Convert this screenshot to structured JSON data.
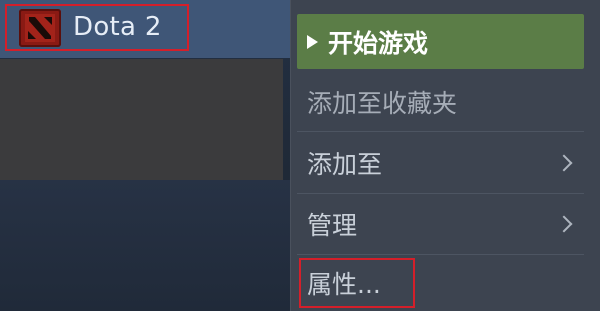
{
  "library": {
    "game": {
      "title": "Dota 2",
      "icon": "dota-logo-icon"
    }
  },
  "context_menu": {
    "play_label": "开始游戏",
    "add_favorites_label": "添加至收藏夹",
    "add_to_label": "添加至",
    "manage_label": "管理",
    "properties_label": "属性..."
  },
  "colors": {
    "play_button": "#5b7d47",
    "highlight_outline": "#d41f2a",
    "menu_bg": "#3d4450"
  }
}
